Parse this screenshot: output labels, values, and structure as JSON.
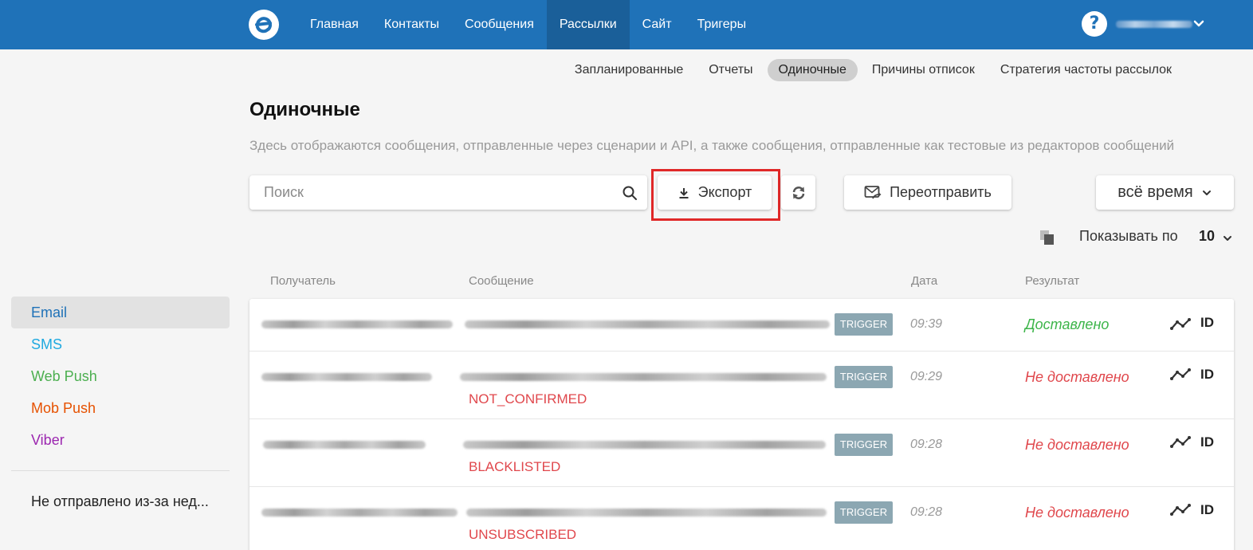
{
  "nav": {
    "items": [
      "Главная",
      "Контакты",
      "Сообщения",
      "Рассылки",
      "Сайт",
      "Тригеры"
    ],
    "active_index": 3,
    "help_label": "?"
  },
  "subnav": {
    "items": [
      "Запланированные",
      "Отчеты",
      "Одиночные",
      "Причины отписок",
      "Стратегия частоты рассылок"
    ],
    "active_index": 2
  },
  "page": {
    "title": "Одиночные",
    "description": "Здесь отображаются сообщения, отправленные через сценарии и API, а также сообщения, отправленные как тестовые из редакторов сообщений"
  },
  "toolbar": {
    "search_placeholder": "Поиск",
    "export_label": "Экспорт",
    "resend_label": "Переотправить",
    "period_label": "всё время",
    "perpage_label": "Показывать по",
    "perpage_value": "10"
  },
  "sidebar": {
    "channels": [
      {
        "label": "Email",
        "color": "#1f72b8"
      },
      {
        "label": "SMS",
        "color": "#1fa9e0"
      },
      {
        "label": "Web Push",
        "color": "#4caf50"
      },
      {
        "label": "Mob Push",
        "color": "#e65100"
      },
      {
        "label": "Viber",
        "color": "#9c27b0"
      }
    ],
    "active_index": 0,
    "undelivered_label": "Не отправлено из-за нед..."
  },
  "table": {
    "columns": [
      "Получатель",
      "Сообщение",
      "Дата",
      "Результат"
    ],
    "rows": [
      {
        "tag": "TRIGGER",
        "time": "09:39",
        "result": "Доставлено",
        "status": "ok",
        "error": "",
        "id_label": "ID"
      },
      {
        "tag": "TRIGGER",
        "time": "09:29",
        "result": "Не доставлено",
        "status": "fail",
        "error": "NOT_CONFIRMED",
        "id_label": "ID"
      },
      {
        "tag": "TRIGGER",
        "time": "09:28",
        "result": "Не доставлено",
        "status": "fail",
        "error": "BLACKLISTED",
        "id_label": "ID"
      },
      {
        "tag": "TRIGGER",
        "time": "09:28",
        "result": "Не доставлено",
        "status": "fail",
        "error": "UNSUBSCRIBED",
        "id_label": "ID"
      }
    ]
  },
  "colors": {
    "brand": "#1f72b8",
    "success": "#3db54a",
    "error": "#e0474c",
    "tag": "#8ca7b2",
    "highlight": "#e02828"
  }
}
